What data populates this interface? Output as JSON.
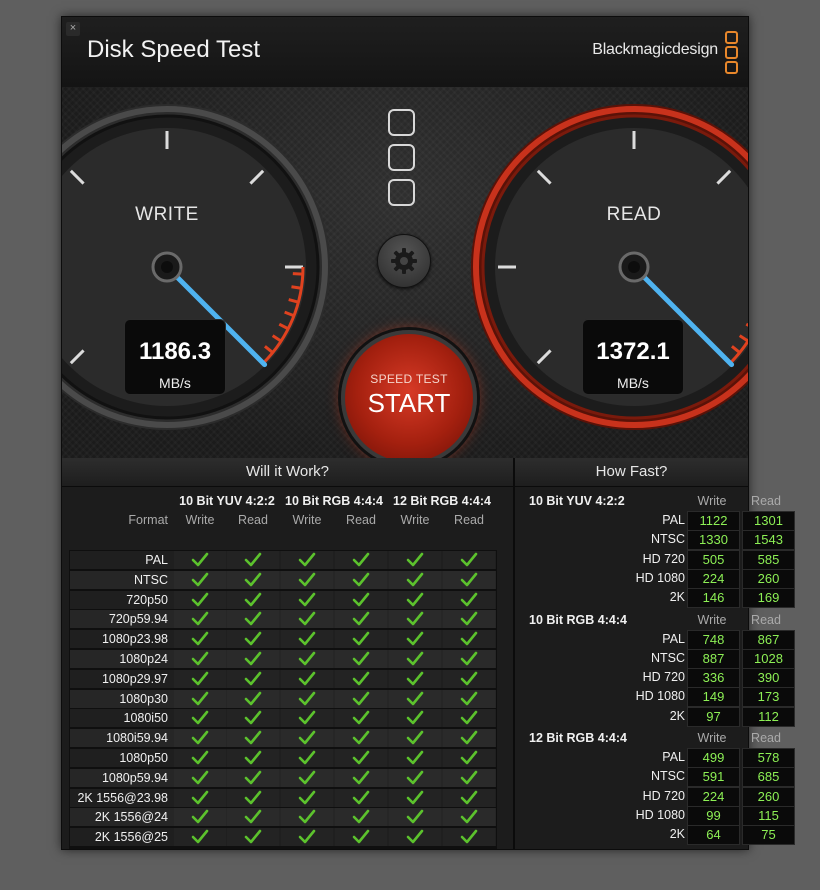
{
  "window": {
    "title": "Disk Speed Test",
    "brand": "Blackmagicdesign",
    "close_label": "×"
  },
  "gauges": {
    "write": {
      "label": "WRITE",
      "value": "1186.3",
      "unit": "MB/s"
    },
    "read": {
      "label": "READ",
      "value": "1372.1",
      "unit": "MB/s"
    }
  },
  "start_button": {
    "small": "SPEED TEST",
    "big": "START"
  },
  "will_it_work": {
    "title": "Will it Work?",
    "format_header": "Format",
    "columns": [
      "10 Bit YUV 4:2:2",
      "10 Bit RGB 4:4:4",
      "12 Bit RGB 4:4:4"
    ],
    "sub_columns": [
      "Write",
      "Read"
    ],
    "formats": [
      "PAL",
      "NTSC",
      "720p50",
      "720p59.94",
      "1080p23.98",
      "1080p24",
      "1080p29.97",
      "1080p30",
      "1080i50",
      "1080i59.94",
      "1080p50",
      "1080p59.94",
      "2K 1556@23.98",
      "2K 1556@24",
      "2K 1556@25"
    ],
    "check_icon": "checkmark-icon",
    "check_color": "#5cc22d"
  },
  "how_fast": {
    "title": "How Fast?",
    "sub_columns": [
      "Write",
      "Read"
    ],
    "groups": [
      {
        "name": "10 Bit YUV 4:2:2",
        "rows": [
          {
            "label": "PAL",
            "write": "1122",
            "read": "1301"
          },
          {
            "label": "NTSC",
            "write": "1330",
            "read": "1543"
          },
          {
            "label": "HD 720",
            "write": "505",
            "read": "585"
          },
          {
            "label": "HD 1080",
            "write": "224",
            "read": "260"
          },
          {
            "label": "2K",
            "write": "146",
            "read": "169"
          }
        ]
      },
      {
        "name": "10 Bit RGB 4:4:4",
        "rows": [
          {
            "label": "PAL",
            "write": "748",
            "read": "867"
          },
          {
            "label": "NTSC",
            "write": "887",
            "read": "1028"
          },
          {
            "label": "HD 720",
            "write": "336",
            "read": "390"
          },
          {
            "label": "HD 1080",
            "write": "149",
            "read": "173"
          },
          {
            "label": "2K",
            "write": "97",
            "read": "112"
          }
        ]
      },
      {
        "name": "12 Bit RGB 4:4:4",
        "rows": [
          {
            "label": "PAL",
            "write": "499",
            "read": "578"
          },
          {
            "label": "NTSC",
            "write": "591",
            "read": "685"
          },
          {
            "label": "HD 720",
            "write": "224",
            "read": "260"
          },
          {
            "label": "HD 1080",
            "write": "99",
            "read": "115"
          },
          {
            "label": "2K",
            "write": "64",
            "read": "75"
          }
        ]
      }
    ]
  },
  "colors": {
    "needle": "#4fb3f0",
    "read_ring": "#c8321c",
    "accent_orange": "#e8872b",
    "value_green": "#8df055"
  }
}
